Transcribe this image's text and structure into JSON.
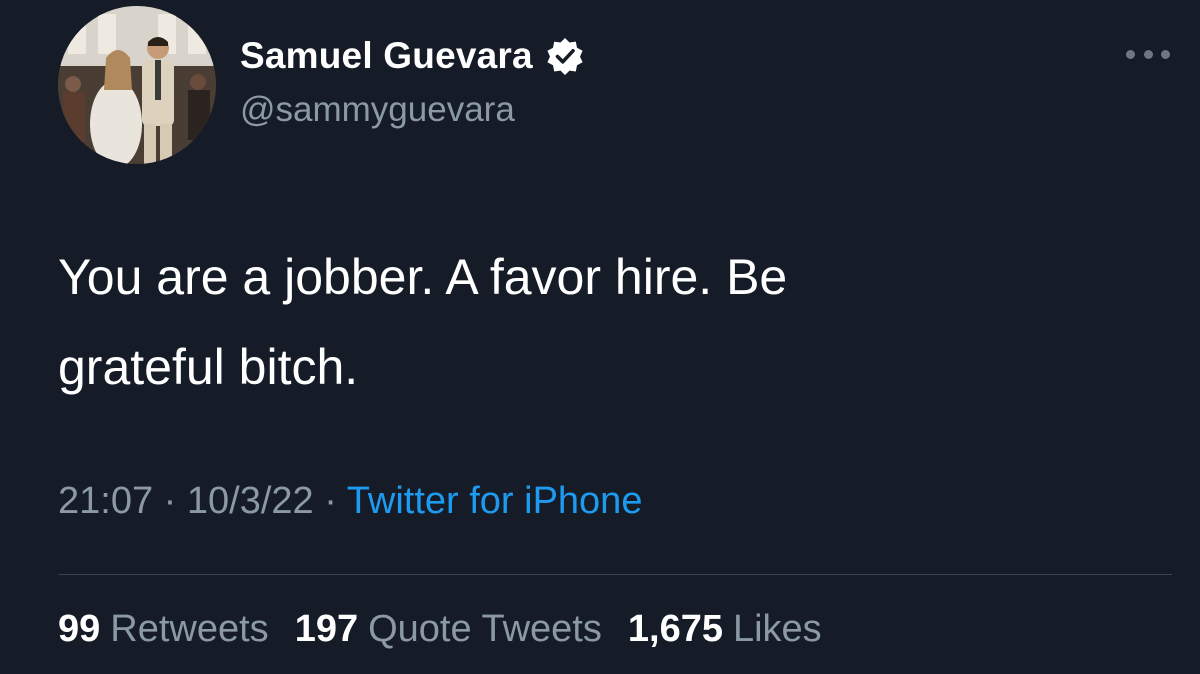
{
  "author": {
    "display_name": "Samuel Guevara",
    "handle": "@sammyguevara",
    "verified": true
  },
  "tweet": {
    "text_line_1": "You are a jobber. A favor hire. Be",
    "text_line_2": "grateful bitch.",
    "time": "21:07",
    "date": "10/3/22",
    "separator": "·",
    "source": "Twitter for iPhone"
  },
  "stats": {
    "retweets": {
      "count": "99",
      "label": "Retweets"
    },
    "quote_tweets": {
      "count": "197",
      "label": "Quote Tweets"
    },
    "likes": {
      "count": "1,675",
      "label": "Likes"
    }
  },
  "icons": {
    "verified": "verified-badge-icon",
    "more": "more-options-icon"
  },
  "colors": {
    "background": "#151c27",
    "text_primary": "#ffffff",
    "text_secondary": "#8b98a5",
    "link": "#1d9bf0",
    "divider": "#38444d"
  }
}
